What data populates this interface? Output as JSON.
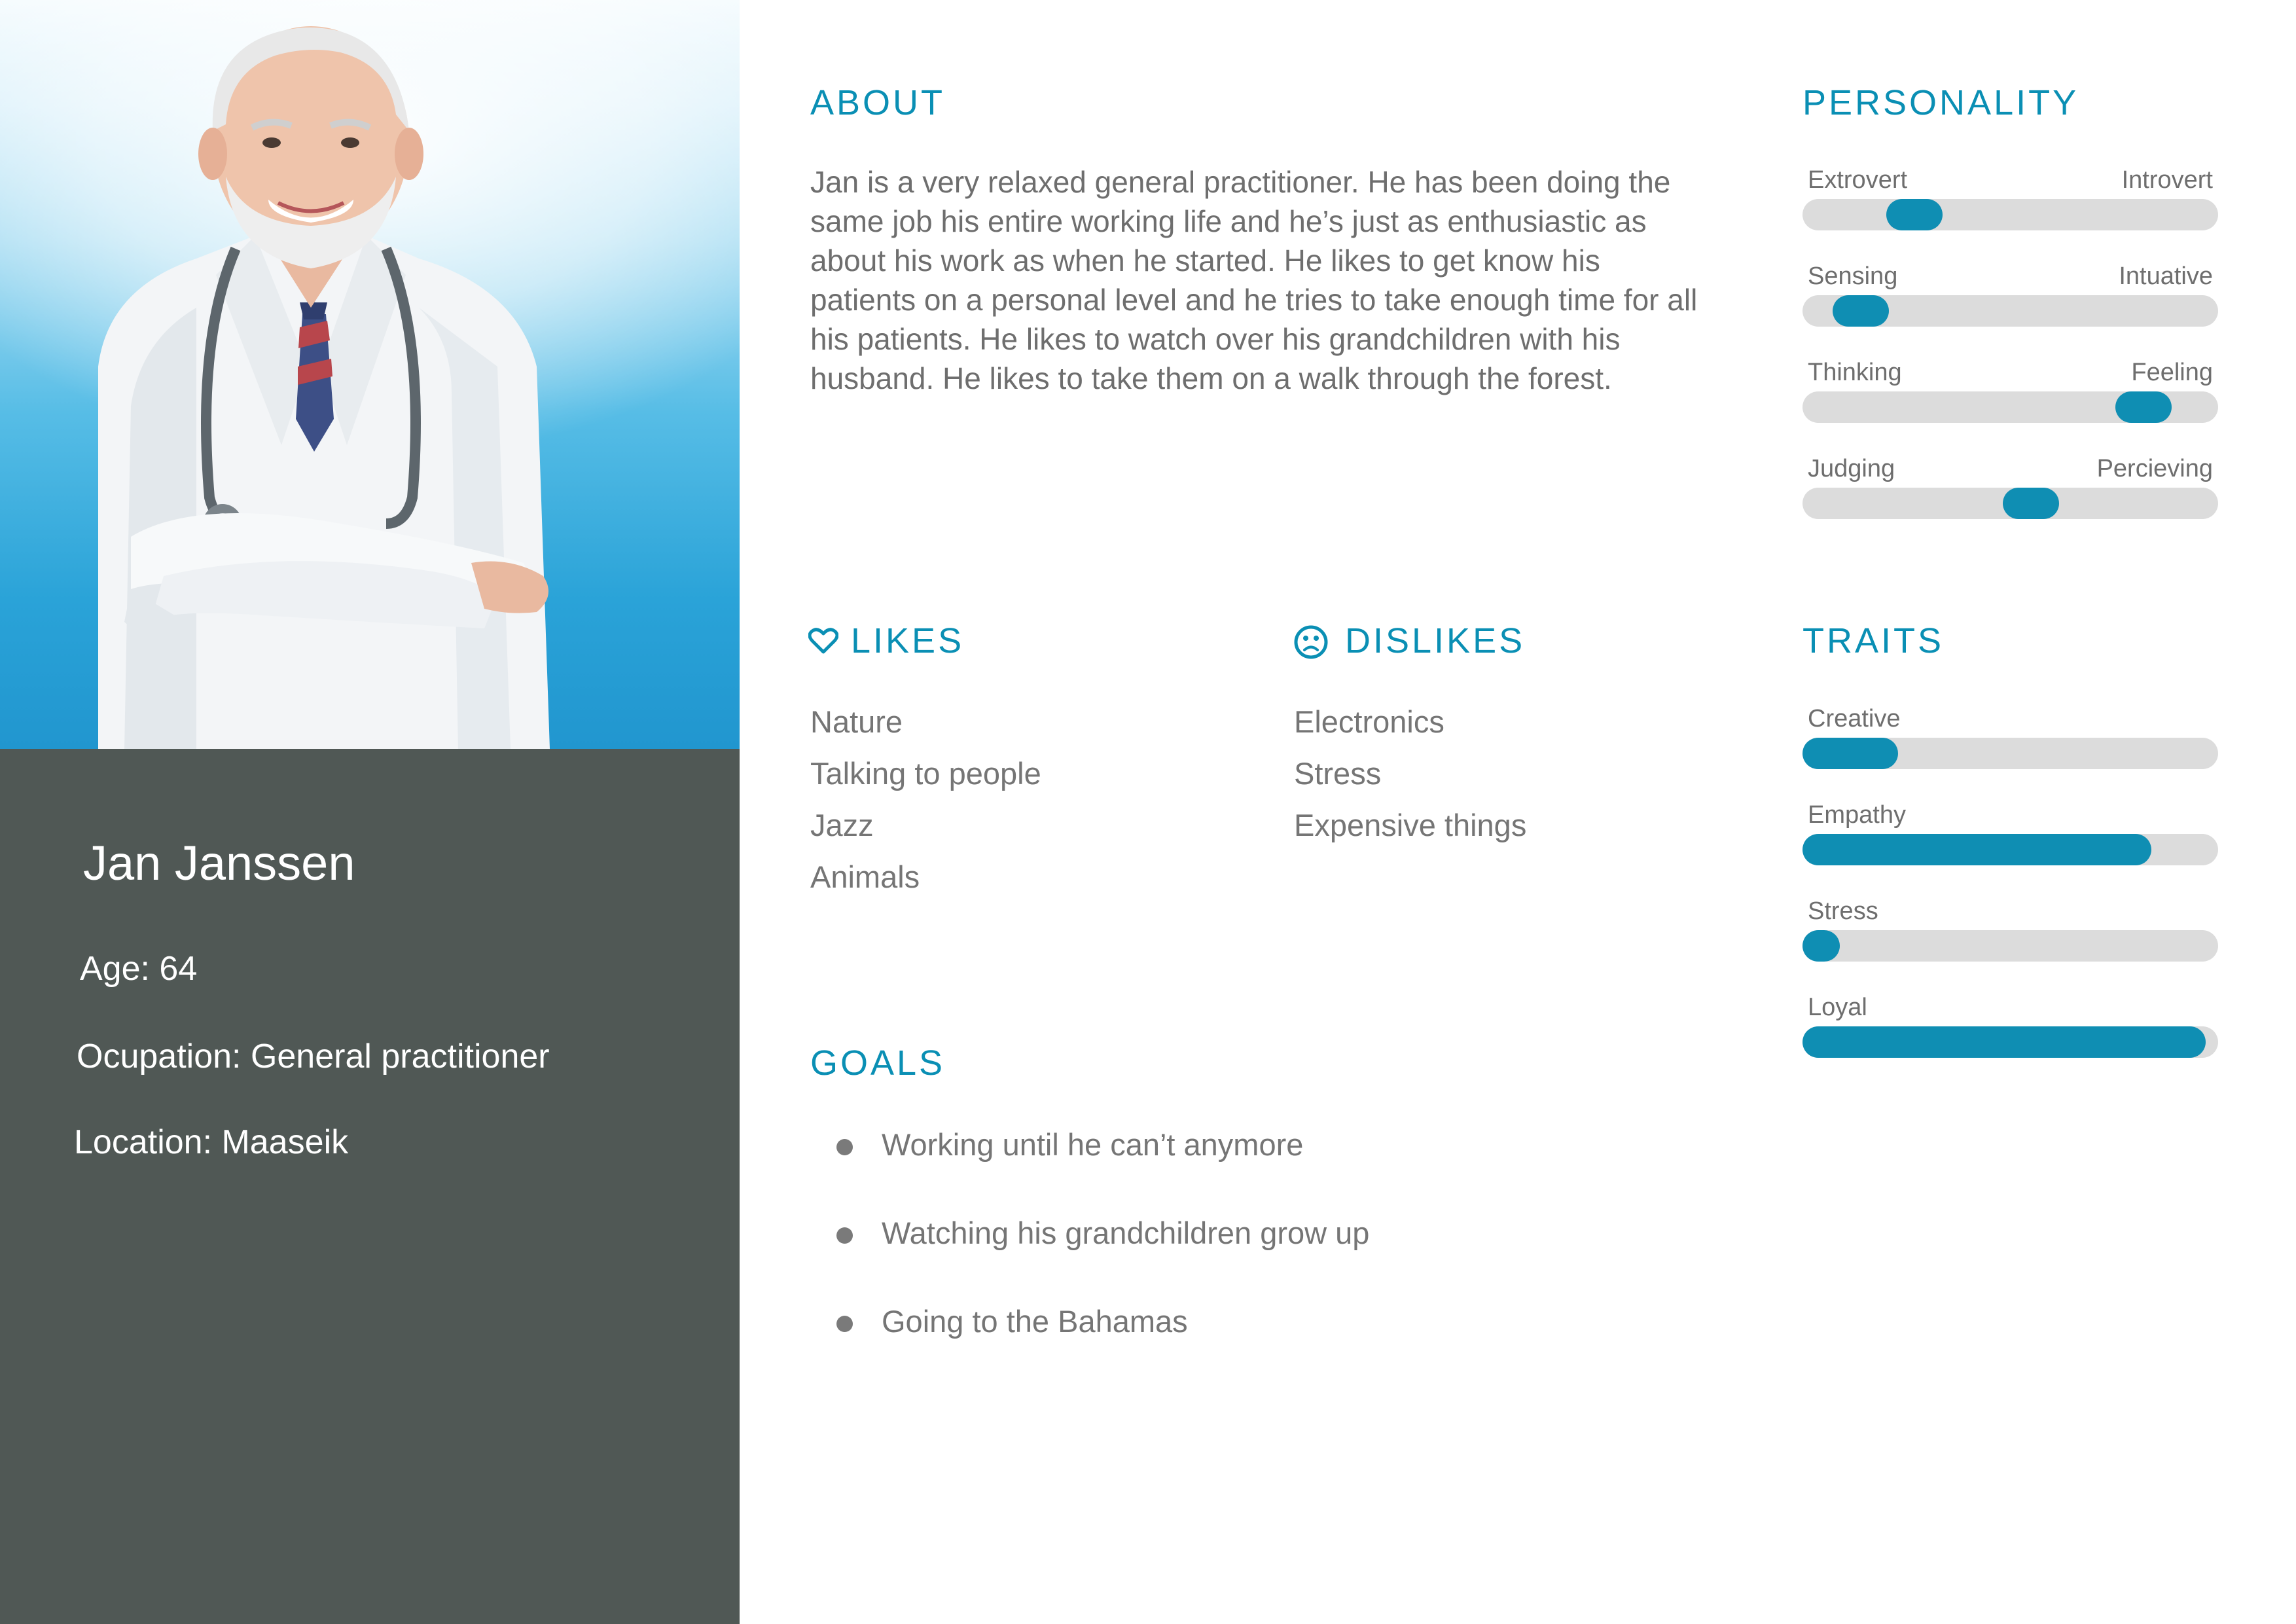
{
  "persona": {
    "name": "Jan Janssen",
    "age": "Age: 64",
    "occupation": "Ocupation: General practitioner",
    "location": "Location: Maaseik"
  },
  "about": {
    "heading": "ABOUT",
    "lines": [
      "Jan is a very relaxed general practitioner. He has been doing the",
      "same job his entire working life and he’s just as enthusiastic as",
      "about his work as when he started. He likes to get know his",
      "patients on a personal level and he tries to take enough time for all",
      "his patients. He likes to watch over his grandchildren with his",
      "husband. He likes to take them on a walk through the forest."
    ]
  },
  "personality": {
    "heading": "PERSONALITY",
    "scales": [
      {
        "left": "Extrovert",
        "right": "Introvert",
        "position": 0.27
      },
      {
        "left": "Sensing",
        "right": "Intuative",
        "position": 0.14
      },
      {
        "left": "Thinking",
        "right": "Feeling",
        "position": 0.82
      },
      {
        "left": "Judging",
        "right": "Percieving",
        "position": 0.55
      }
    ]
  },
  "likes": {
    "heading": "LIKES",
    "icon": "heart-icon",
    "items": [
      "Nature",
      "Talking to people",
      "Jazz",
      "Animals"
    ]
  },
  "dislikes": {
    "heading": "DISLIKES",
    "icon": "sad-face-icon",
    "items": [
      "Electronics",
      "Stress",
      "Expensive things"
    ]
  },
  "traits": {
    "heading": "TRAITS",
    "bars": [
      {
        "label": "Creative",
        "level": 0.23
      },
      {
        "label": "Empathy",
        "level": 0.84
      },
      {
        "label": "Stress",
        "level": 0.09
      },
      {
        "label": "Loyal",
        "level": 0.97
      }
    ]
  },
  "goals": {
    "heading": "GOALS",
    "items": [
      "Working until he can’t anymore",
      "Watching his grandchildren grow up",
      "Going to the Bahamas"
    ]
  },
  "colors": {
    "accent": "#0f8eb3",
    "heading": "#0a8fb4",
    "panel": "#505855",
    "track": "#dcdcdc",
    "text": "#6e6e6e"
  }
}
